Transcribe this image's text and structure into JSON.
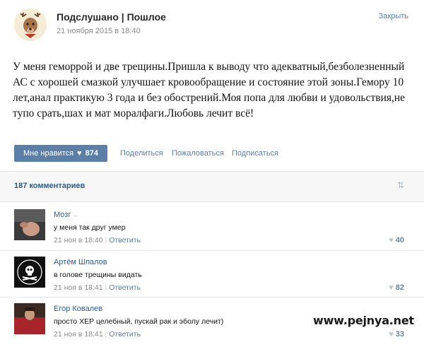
{
  "post": {
    "group_name": "Подслушано | Пошлое",
    "date": "21 ноября 2015 в 18:40",
    "close_label": "Закрыть",
    "text": "У меня геморрой и две трещины.Пришла к выводу что адекватный,безболезненный АС с хорошей смазкой улучшает кровообращение и состояние этой зоны.Гемору 10 лет,анал практикую 3 года и без обострений.Моя попа для любви и удовольствия,не тупо срать,шах и мат моралфаги.Любовь лечит всё!",
    "like_label": "Мне нравится",
    "like_count": "874",
    "actions": {
      "share": "Поделиться",
      "report": "Пожаловаться",
      "subscribe": "Подписаться"
    }
  },
  "comments_header": {
    "count_label": "187 комментариев",
    "sort_icon": "sort-arrows-icon"
  },
  "comments": [
    {
      "author": "Мозг",
      "text": "у меня так друг умер",
      "time": "21 ноя в 18:40",
      "reply": "Ответить",
      "likes": "40"
    },
    {
      "author": "Артём Шпалов",
      "text": "в голове трещины видать",
      "time": "21 ноя в 18:41",
      "reply": "Ответить",
      "likes": "82"
    },
    {
      "author": "Егор Ковалев",
      "text": "просто ХЕР целебный, пускай рак и эболу лечит)",
      "time": "21 ноя в 18:41",
      "reply": "Ответить",
      "likes": "33"
    }
  ],
  "watermark": "www.pejnya.net",
  "colors": {
    "accent": "#5b7fa6",
    "link": "#2f5a88",
    "meta": "#8a8a8a"
  }
}
